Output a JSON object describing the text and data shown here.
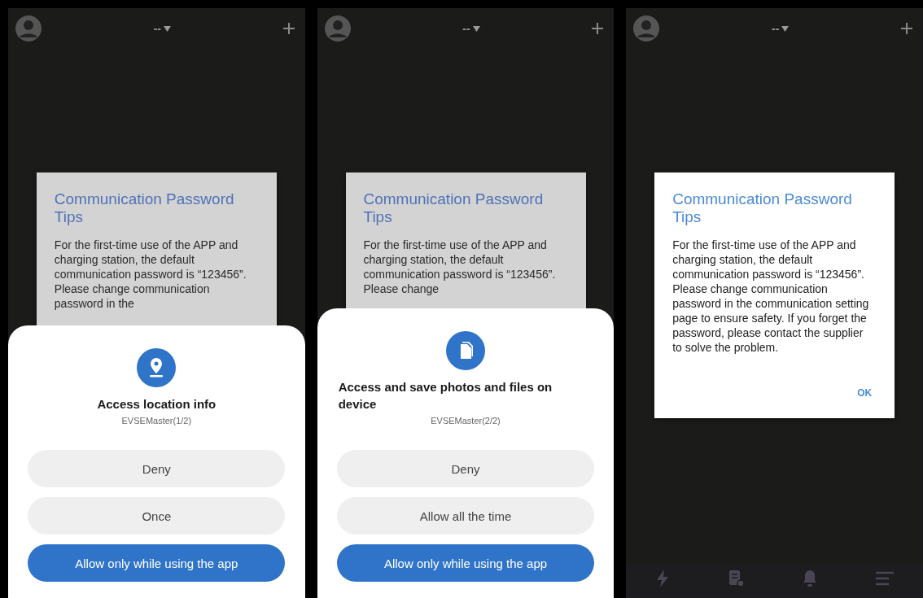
{
  "screens": [
    {
      "top_bar": {
        "title": "--"
      },
      "dialog": {
        "dimmed": true,
        "title": "Communication Password Tips",
        "body": "For the first-time use of the APP and charging station, the default communication password is “123456”. Please change communication password in the"
      },
      "permission_sheet": {
        "kind": "location",
        "title": "Access location info",
        "subtitle": "EVSEMaster(1/2)",
        "buttons": [
          {
            "label": "Deny",
            "primary": false
          },
          {
            "label": "Once",
            "primary": false
          },
          {
            "label": "Allow only while using the app",
            "primary": true
          }
        ]
      }
    },
    {
      "top_bar": {
        "title": "--"
      },
      "dialog": {
        "dimmed": true,
        "title": "Communication Password Tips",
        "body": "For the first-time use of the APP and charging station, the default communication password is “123456”. Please change"
      },
      "permission_sheet": {
        "kind": "files",
        "title": "Access and save photos and files on device",
        "subtitle": "EVSEMaster(2/2)",
        "buttons": [
          {
            "label": "Deny",
            "primary": false
          },
          {
            "label": "Allow all the time",
            "primary": false
          },
          {
            "label": "Allow only while using the app",
            "primary": true
          }
        ]
      }
    },
    {
      "top_bar": {
        "title": "--"
      },
      "dialog": {
        "dimmed": false,
        "title": "Communication Password Tips",
        "body": "For the first-time use of the APP and charging station, the default communication password is “123456”. Please change communication password in the communication setting page to ensure safety. If you forget the password, please contact the supplier to solve the problem.",
        "action": "OK"
      },
      "bottom_nav": true
    }
  ]
}
